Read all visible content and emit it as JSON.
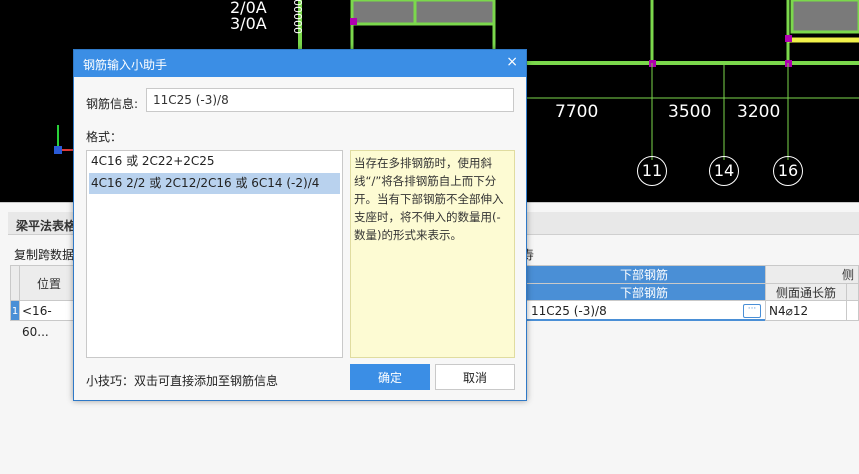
{
  "cad": {
    "top_labels": [
      "2/0A",
      "3/0A"
    ],
    "vertical_text": "000000",
    "dimensions": [
      "7700",
      "3500",
      "3200"
    ],
    "axis_numbers": [
      "11",
      "14",
      "16"
    ],
    "colors": {
      "beam": "#7bd84c",
      "slab": "#7a7a7a",
      "joint": "#b000b0",
      "highlight": "#f1f14a"
    }
  },
  "panel": {
    "title": "梁平法表格",
    "copy_label": "复制跨数据",
    "tail_text": "寿",
    "row_num": "1",
    "col_position": "位置",
    "position_value": "<16-60...",
    "bottom_group_header": "下部钢筋",
    "bottom_header": "下部钢筋",
    "bottom_value": "11C25 (-3)/8",
    "side_group_header": "侧",
    "side_header": "侧面通长筋",
    "side_value": "N4⌀12"
  },
  "dialog": {
    "title": "钢筋输入小助手",
    "close_icon": "×",
    "info_label": "钢筋信息:",
    "info_value": "11C25 (-3)/8",
    "format_label": "格式：",
    "formats": [
      "4C16 或 2C22+2C25",
      "4C16 2/2 或 2C12/2C16 或 6C14 (-2)/4"
    ],
    "selected_index": 1,
    "help": "当存在多排钢筋时，使用斜线“/”将各排钢筋自上而下分开。当有下部钢筋不全部伸入支座时，将不伸入的数量用(-数量)的形式来表示。",
    "tip": "小技巧：双击可直接添加至钢筋信息",
    "ok_label": "确定",
    "cancel_label": "取消"
  }
}
